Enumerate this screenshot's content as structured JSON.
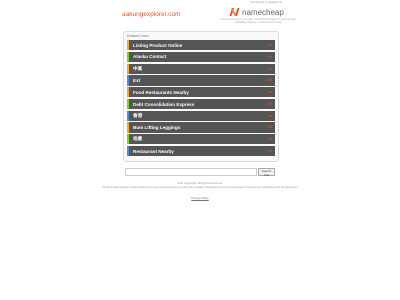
{
  "header": {
    "domain": "aakungexplorer.com",
    "ad_notice": "This domain is registered at",
    "brand_name": "namecheap",
    "brand_text": "This domain may be for sale. Check Namecheap for more domain availability. Register a new domain today!"
  },
  "related": {
    "title": "Related Links",
    "arrow": ">>",
    "items": [
      {
        "label": "Listing Product Online",
        "accent": "#f5a623"
      },
      {
        "label": "Alaska Contact",
        "accent": "#7ed321"
      },
      {
        "label": "中高",
        "accent": "#f5a623"
      },
      {
        "label": "Ext",
        "accent": "#4a90e2"
      },
      {
        "label": "Food Restaurants Nearby",
        "accent": "#f5a623"
      },
      {
        "label": "Debt Consolidation Express",
        "accent": "#7ed321"
      },
      {
        "label": "香港",
        "accent": "#4a90e2"
      },
      {
        "label": "Bum Lifting Leggings",
        "accent": "#f5a623"
      },
      {
        "label": "地產",
        "accent": "#7ed321"
      },
      {
        "label": "Restaurant Nearby",
        "accent": "#4a90e2"
      }
    ]
  },
  "search": {
    "value": "",
    "placeholder": "",
    "button_label": "Search Ads"
  },
  "footer": {
    "copyright": "2022 Copyright. All Rights Reserved.",
    "disclaimer": "The Sponsored Listings displayed above are served automatically by a third party. Neither Parkingcrew nor the domain owner maintain any relationship with the advertisers.",
    "privacy": "Privacy Policy"
  },
  "colors": {
    "accent": "#e8572a",
    "link_bg": "#555555"
  }
}
